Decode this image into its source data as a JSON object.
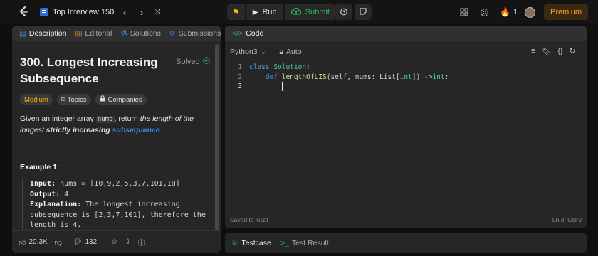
{
  "topbar": {
    "problem_list_label": "Top Interview 150",
    "run_label": "Run",
    "submit_label": "Submit",
    "streak_count": "1",
    "premium_label": "Premium"
  },
  "left_tabs": [
    {
      "label": "Description"
    },
    {
      "label": "Editorial"
    },
    {
      "label": "Solutions"
    },
    {
      "label": "Submissions"
    }
  ],
  "problem": {
    "title": "300. Longest Increasing Subsequence",
    "status": "Solved",
    "difficulty": "Medium",
    "topics_label": "Topics",
    "companies_label": "Companies",
    "desc_prefix": "Given an integer array ",
    "desc_code": "nums",
    "desc_mid": ", return ",
    "desc_em": "the length of the longest ",
    "desc_strong": "strictly increasing",
    "desc_link": "subsequence",
    "desc_end": ".",
    "example_title": "Example 1:",
    "input_label": "Input:",
    "input_value": " nums = [10,9,2,5,3,7,101,18]",
    "output_label": "Output:",
    "output_value": " 4",
    "explanation_label": "Explanation:",
    "explanation_value": " The longest increasing subsequence is [2,3,7,101], therefore the length is 4."
  },
  "bottom_bar": {
    "likes": "20.3K",
    "comments": "132"
  },
  "code_panel": {
    "title": "Code",
    "language": "Python3",
    "auto_label": "Auto",
    "lines": [
      {
        "n": "1"
      },
      {
        "n": "2"
      },
      {
        "n": "3"
      }
    ],
    "saved_text": "Saved to local",
    "cursor_pos": "Ln 3, Col 9"
  },
  "test_panel": {
    "testcase_label": "Testcase",
    "result_label": "Test Result"
  },
  "colors": {
    "accent_orange": "#ffa116",
    "submit_green": "#2cbb5d",
    "medium_yellow": "#ffb800",
    "link_blue": "#3b8ee8"
  }
}
